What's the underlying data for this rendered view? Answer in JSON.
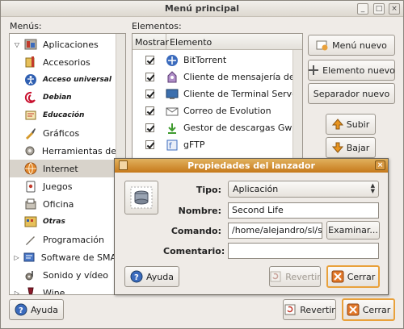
{
  "window": {
    "title": "Menú principal",
    "buttons": {
      "minimize": "_",
      "maximize": "□",
      "close": "×"
    }
  },
  "menus_label": "Menús:",
  "elements_label": "Elementos:",
  "tree": {
    "items": [
      {
        "label": "Aplicaciones",
        "icon": "applications-icon",
        "expanded": true,
        "level": 0
      },
      {
        "label": "Accesorios",
        "icon": "accessories-icon",
        "level": 1
      },
      {
        "label": "Acceso universal",
        "icon": "universal-access-icon",
        "level": 1,
        "small": true
      },
      {
        "label": "Debian",
        "icon": "debian-icon",
        "level": 1,
        "small": true
      },
      {
        "label": "Educación",
        "icon": "education-icon",
        "level": 1,
        "small": true
      },
      {
        "label": "Gráficos",
        "icon": "graphics-icon",
        "level": 1
      },
      {
        "label": "Herramientas de",
        "icon": "tools-icon",
        "level": 1
      },
      {
        "label": "Internet",
        "icon": "internet-icon",
        "level": 1,
        "selected": true
      },
      {
        "label": "Juegos",
        "icon": "games-icon",
        "level": 1
      },
      {
        "label": "Oficina",
        "icon": "office-icon",
        "level": 1
      },
      {
        "label": "Otras",
        "icon": "other-icon",
        "level": 1,
        "small": true
      },
      {
        "label": "Programación",
        "icon": "programming-icon",
        "level": 1
      },
      {
        "label": "Software de SMA",
        "icon": "software-icon",
        "level": 1,
        "collapsed": true
      },
      {
        "label": "Sonido y vídeo",
        "icon": "sound-video-icon",
        "level": 1
      },
      {
        "label": "Wine",
        "icon": "wine-icon",
        "level": 1,
        "collapsed": true
      }
    ]
  },
  "list": {
    "col_show": "Mostrar",
    "col_element": "Elemento",
    "rows": [
      {
        "label": "BitTorrent",
        "checked": true,
        "icon": "bittorrent-icon"
      },
      {
        "label": "Cliente de mensajería de Internet",
        "checked": true,
        "icon": "messaging-icon"
      },
      {
        "label": "Cliente de Terminal Server",
        "checked": true,
        "icon": "terminal-server-icon"
      },
      {
        "label": "Correo de Evolution",
        "checked": true,
        "icon": "evolution-icon"
      },
      {
        "label": "Gestor de descargas Gwget",
        "checked": true,
        "icon": "gwget-icon"
      },
      {
        "label": "gFTP",
        "checked": true,
        "icon": "gftp-icon"
      }
    ]
  },
  "side_buttons": {
    "new_menu": "Menú nuevo",
    "new_item": "Elemento nuevo",
    "new_separator": "Separador nuevo",
    "move_up": "Subir",
    "move_down": "Bajar"
  },
  "bottom": {
    "help": "Ayuda",
    "revert": "Revertir",
    "close": "Cerrar"
  },
  "dialog": {
    "title": "Propiedades del lanzador",
    "type_label": "Tipo:",
    "type_value": "Aplicación",
    "name_label": "Nombre:",
    "name_value": "Second Life",
    "command_label": "Comando:",
    "command_value": "/home/alejandro/sl/seco",
    "browse": "Examinar...",
    "comment_label": "Comentario:",
    "comment_value": "",
    "help": "Ayuda",
    "revert": "Revertir",
    "close": "Cerrar"
  },
  "colors": {
    "window_bg": "#efebe7",
    "dialog_title": "#d08a2a",
    "focus_ring": "#e9a13b",
    "selection": "#d8d3cb"
  }
}
